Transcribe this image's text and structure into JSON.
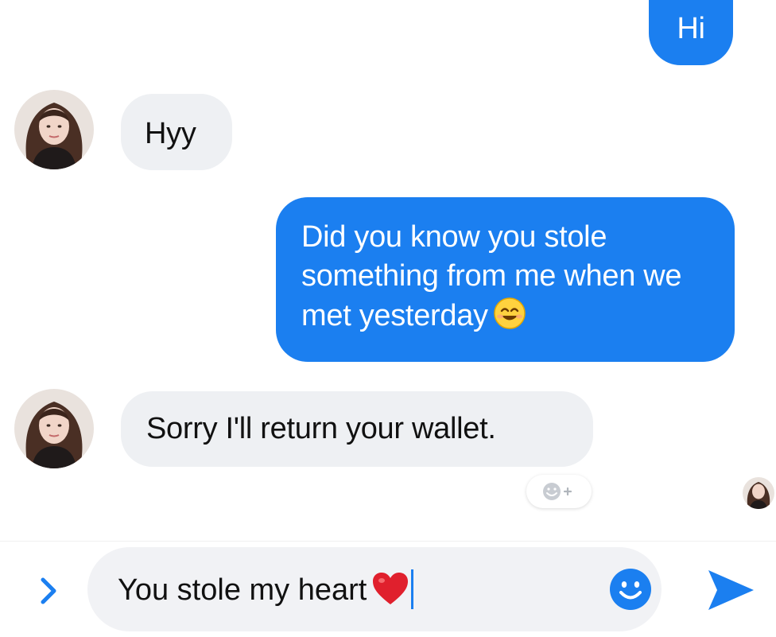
{
  "conversation": {
    "messages": [
      {
        "direction": "out",
        "text": "Hi"
      },
      {
        "direction": "in",
        "text": "Hyy"
      },
      {
        "direction": "out",
        "text": "Did you know you stole something from me when we met yesterday",
        "emoji": "smiling-face-icon"
      },
      {
        "direction": "in",
        "text": "Sorry I'll return your wallet."
      }
    ],
    "reaction_button_icon": "add-reaction-icon"
  },
  "composer": {
    "draft_text": "You stole my heart",
    "draft_emoji": "red-heart-icon",
    "expand_icon": "chevron-right-icon",
    "emoji_icon": "smiley-icon",
    "send_icon": "send-arrow-icon"
  },
  "colors": {
    "accent": "#1b7ff0",
    "incoming_bubble": "#eef0f3",
    "background": "#ffffff"
  }
}
